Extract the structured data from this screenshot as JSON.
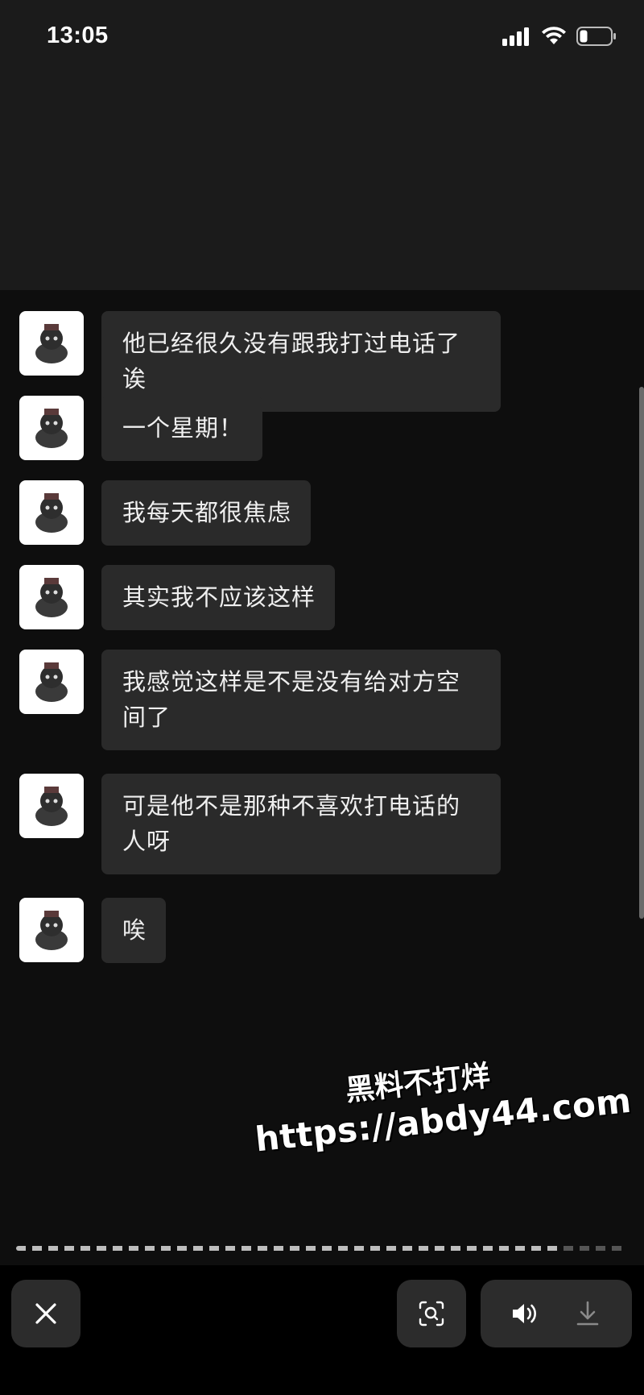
{
  "status_bar": {
    "time": "13:05",
    "icons": [
      "signal-icon",
      "wifi-icon",
      "battery-icon"
    ]
  },
  "messages": [
    {
      "text": "他已经很久没有跟我打过电话了诶"
    },
    {
      "text": "一个星期！"
    },
    {
      "text": "我每天都很焦虑"
    },
    {
      "text": "其实我不应该这样"
    },
    {
      "text": "我感觉这样是不是没有给对方空间了"
    },
    {
      "text": "可是他不是那种不喜欢打电话的人呀"
    },
    {
      "text": "唉"
    }
  ],
  "watermark": {
    "line1": "黑料不打烊",
    "line2": "https://abdy44.com"
  },
  "toolbar": {
    "close_icon": "close-icon",
    "scan_icon": "scan-text-icon",
    "sound_icon": "speaker-icon",
    "download_icon": "download-icon"
  },
  "colors": {
    "background": "#0e0e0e",
    "bubble": "#2a2a2a",
    "text": "#efefef"
  }
}
